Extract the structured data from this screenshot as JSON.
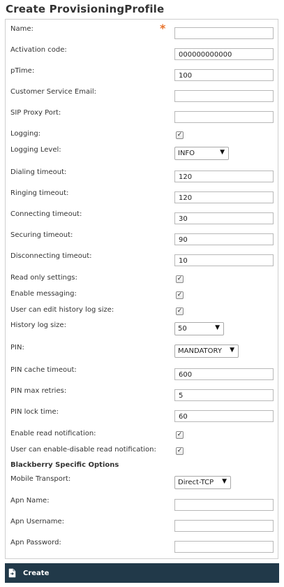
{
  "page_title": "Create ProvisioningProfile",
  "fields": {
    "name": {
      "label": "Name:",
      "value": "",
      "required_mark": "*"
    },
    "activation_code": {
      "label": "Activation code:",
      "value": "000000000000"
    },
    "ptime": {
      "label": "pTime:",
      "value": "100"
    },
    "customer_service_email": {
      "label": "Customer Service Email:",
      "value": ""
    },
    "sip_proxy_port": {
      "label": "SIP Proxy Port:",
      "value": ""
    },
    "logging": {
      "label": "Logging:",
      "checked": true
    },
    "logging_level": {
      "label": "Logging Level:",
      "value": "INFO"
    },
    "dialing_timeout": {
      "label": "Dialing timeout:",
      "value": "120"
    },
    "ringing_timeout": {
      "label": "Ringing timeout:",
      "value": "120"
    },
    "connecting_timeout": {
      "label": "Connecting timeout:",
      "value": "30"
    },
    "securing_timeout": {
      "label": "Securing timeout:",
      "value": "90"
    },
    "disconnecting_timeout": {
      "label": "Disconnecting timeout:",
      "value": "10"
    },
    "read_only_settings": {
      "label": "Read only settings:",
      "checked": true
    },
    "enable_messaging": {
      "label": "Enable messaging:",
      "checked": true
    },
    "edit_history_log_size": {
      "label": "User can edit history log size:",
      "checked": true
    },
    "history_log_size": {
      "label": "History log size:",
      "value": "50"
    },
    "pin": {
      "label": "PIN:",
      "value": "MANDATORY"
    },
    "pin_cache_timeout": {
      "label": "PIN cache timeout:",
      "value": "600"
    },
    "pin_max_retries": {
      "label": "PIN max retries:",
      "value": "5"
    },
    "pin_lock_time": {
      "label": "PIN lock time:",
      "value": "60"
    },
    "enable_read_notification": {
      "label": "Enable read notification:",
      "checked": true
    },
    "enable_disable_read_notification": {
      "label": "User can enable-disable read notification:",
      "checked": true
    }
  },
  "blackberry": {
    "section_title": "Blackberry Specific Options",
    "mobile_transport": {
      "label": "Mobile Transport:",
      "value": "Direct-TCP"
    },
    "apn_name": {
      "label": "Apn Name:",
      "value": ""
    },
    "apn_username": {
      "label": "Apn Username:",
      "value": ""
    },
    "apn_password": {
      "label": "Apn Password:",
      "value": ""
    }
  },
  "actions": {
    "create_label": "Create",
    "create_icon": "document-arrow-icon"
  },
  "colors": {
    "required": "#e8722a",
    "action_bar": "#213949"
  },
  "glyphs": {
    "check": "✓",
    "dropdown": "▼"
  }
}
